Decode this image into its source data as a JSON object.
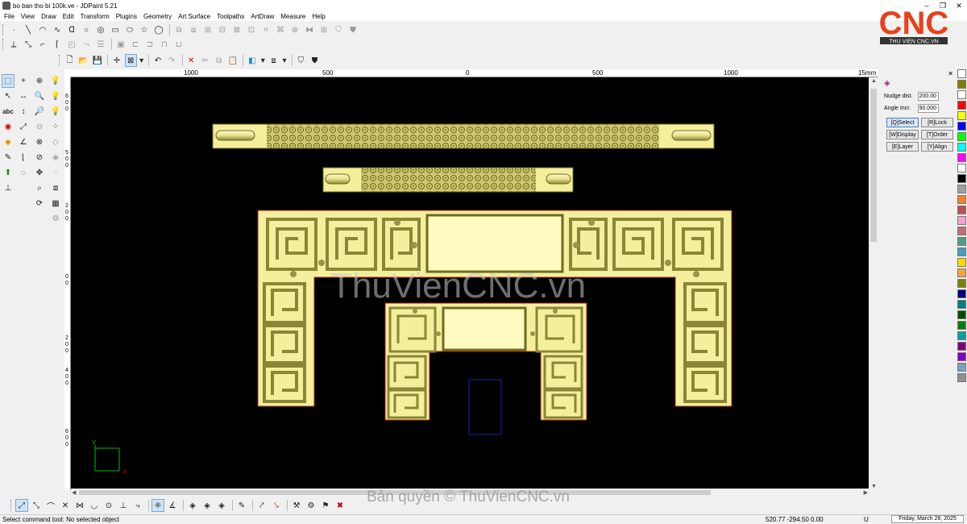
{
  "window": {
    "title": "bo ban tho bi 100k.ve - JDPaint 5.21"
  },
  "menu": [
    "File",
    "View",
    "Draw",
    "Edit",
    "Transform",
    "Plugins",
    "Geometry",
    "Art Surface",
    "Toolpaths",
    "ArtDraw",
    "Measure",
    "Help"
  ],
  "ruler": {
    "h_labels": [
      "1000",
      "500",
      "0",
      "500",
      "1000",
      "15mm"
    ],
    "v_labels": [
      "6",
      "0",
      "0",
      "5",
      "0",
      "0",
      "0",
      "2",
      "0",
      "0",
      "0",
      "2",
      "0",
      "0",
      "4",
      "0",
      "0",
      "6",
      "0",
      "0"
    ]
  },
  "panel": {
    "nudge_label": "Nudge dist.",
    "nudge_value": "200.00",
    "angle_label": "Angle Incr.",
    "angle_value": "90.000",
    "buttons": [
      "[Q]Select",
      "[R]Lock",
      "[W]Display",
      "[T]Order",
      "[E]Layer",
      "[Y]Align"
    ]
  },
  "palette": [
    "#ffffff",
    "#7f7f00",
    "#ffffff",
    "#ff0000",
    "#ffff00",
    "#0000ff",
    "#00ff00",
    "#00ffff",
    "#ff00ff",
    "#ffffff",
    "#000000",
    "#a0a0a0",
    "#ff7f27",
    "#c0504d",
    "#ff9fcf",
    "#c07070",
    "#4fa080",
    "#3fa0c0",
    "#ffd700",
    "#ffa040",
    "#808000",
    "#000080",
    "#008080",
    "#004f00",
    "#008000",
    "#00a0a0",
    "#800080",
    "#8000c0",
    "#7f9fbf",
    "#909090"
  ],
  "logo": {
    "text": "CNC",
    "tagline": "THU VIEN CNC.VN"
  },
  "watermarks": {
    "center": "ThuVienCNC.vn",
    "bottom": "Bản quyền © ThuVienCNC.vn"
  },
  "axes": {
    "y": "Y",
    "x": "X"
  },
  "status": {
    "message": "Select command tool: No selected object",
    "coords": "520.77 -294.50 0.00",
    "unit": "U",
    "date": "Friday, March 28, 2025"
  },
  "colors": {
    "canvas": "#000000",
    "relief": "#f4ef9c",
    "relief_dark": "#8a8636",
    "accent": "#e8401c"
  }
}
